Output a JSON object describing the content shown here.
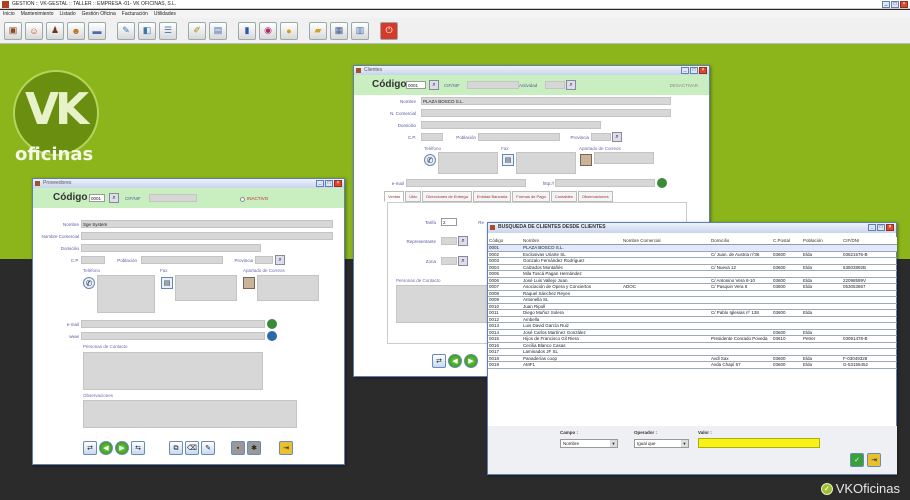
{
  "app": {
    "title": "GESTION :: VK-GESTAL :: TALLER :: EMPRESA -01- VK OFICINAS, S.L.",
    "menu": [
      "Inicio",
      "Mantenimiento",
      "Listado",
      "Gestión Oficina",
      "Facturación",
      "Utilidades"
    ],
    "toolbar_icons": [
      "briefcase-icon",
      "person-icon",
      "people-icon",
      "group-icon",
      "truck-icon",
      "document-icon",
      "edit-icon",
      "list-icon",
      "notebook-icon",
      "chart-icon",
      "globe-icon",
      "coin-icon",
      "folder-icon",
      "calculator-icon",
      "printer-icon",
      "exit-icon"
    ],
    "brand": "VKOficinas",
    "logo_text": "oficinas",
    "logo_mark": "VK"
  },
  "proveedores": {
    "title": "Proveedores",
    "codigo_label": "Código",
    "codigo_value": "0001",
    "cifnif_label": "CIF/NIF",
    "inactivo_label": "INACTIVO",
    "nombre_label": "Nombre",
    "nombre_value": "Sge System",
    "nombre_comercial_label": "Nombre Comercial",
    "domicilio_label": "Domicilio",
    "cp_label": "C.P.",
    "poblacion_label": "Población",
    "provincia_label": "Provincia",
    "telefono_label": "Teléfono",
    "fax_label": "Fax",
    "apartado_label": "Apartado de Correos",
    "email_label": "e-mail",
    "web_label": "www",
    "contacto_label": "Personas de Contacto",
    "observaciones_label": "Observaciones"
  },
  "clientes": {
    "title": "Clientes",
    "codigo_label": "Código",
    "codigo_value": "0001",
    "cifnif_label": "CIF/NIF",
    "actividad_label": "Actividad",
    "desactivar_label": "DESACTIVAR",
    "nombre_label": "Nombre",
    "nombre_value": "PLAZA BOSCO S.L.",
    "nombre_comercial_label": "N. Comercial",
    "domicilio_label": "Domicilio",
    "cp_label": "C.P.",
    "poblacion_label": "Población",
    "provincia_label": "Provincia",
    "telefono_label": "Teléfono",
    "fax_label": "Fax",
    "apartado_label": "Apartado de Correos",
    "email_label": "e-mail",
    "web_label": "http://",
    "tabs": [
      "Ventas",
      "Ubic",
      "Direcciones de Entrega",
      "Entidad Bancaria",
      "Formas de Pago",
      "Contables",
      "Observaciones"
    ],
    "tarifa_label": "Tarifa",
    "tarifa_value": "2",
    "representante_label": "Representante",
    "zona_label": "Zona",
    "recargo_label": "Re",
    "contacto_label": "Personas de Contacto"
  },
  "busqueda": {
    "title": "BUSQUEDA DE CLIENTES DESDE CLIENTES",
    "columns": [
      "Código",
      "Nombre",
      "Nombre Comercial",
      "Domicilio",
      "C.Postal",
      "Población",
      "CIF/DNI"
    ],
    "rows": [
      [
        "0001",
        "PLAZA BOSCO S.L.",
        "",
        "",
        "",
        "",
        ""
      ],
      [
        "0002",
        "Exclusivas Uriarte SL",
        "",
        "C/ Juan. de Austria nº36",
        "03600",
        "Elda",
        "03621576-B"
      ],
      [
        "0003",
        "Gonzalo Fernández Rodríguez",
        "",
        "",
        "",
        "",
        ""
      ],
      [
        "0004",
        "Calzados Montañés",
        "",
        "C/ Nueva 12",
        "03600",
        "Elda",
        "53503892B"
      ],
      [
        "0005",
        "Mila Toscá Pagan Hernández",
        "",
        "",
        "",
        "",
        ""
      ],
      [
        "0006",
        "José Luis Vallejo Juan",
        "",
        "C/ Antonino Vera 8-10",
        "03600",
        "Elda",
        "22098589V"
      ],
      [
        "0007",
        "Asociación de Opera y Conciertos",
        "ADOC",
        "C/ Pasquin Vera 6",
        "03600",
        "Elda",
        "053053867"
      ],
      [
        "0008",
        "Raquel Sánchez Reyes",
        "",
        "",
        "",
        "",
        ""
      ],
      [
        "0009",
        "Antonella SL",
        "",
        "",
        "",
        "",
        ""
      ],
      [
        "0010",
        "Juan Ripoll",
        "",
        "",
        "",
        "",
        ""
      ],
      [
        "0011",
        "Diego Muñoz Solera",
        "",
        "C/ Pablo Iglesias nº 138",
        "03600",
        "Elda",
        ""
      ],
      [
        "0012",
        "Ambella",
        "",
        "",
        "",
        "",
        ""
      ],
      [
        "0013",
        "Luis David García Ruiz",
        "",
        "",
        "",
        "",
        ""
      ],
      [
        "0014",
        "José Carlos Martínez González",
        "",
        "",
        "03600",
        "Elda",
        ""
      ],
      [
        "0015",
        "Hijos de Francisco Gil Riera",
        "",
        "Presidente Conrado Poveda",
        "03610",
        "Petrer",
        "03091478-B"
      ],
      [
        "0016",
        "Cecilia Blanco Casas",
        "",
        "",
        "",
        "",
        ""
      ],
      [
        "0017",
        "Laminados JF SL",
        "",
        "",
        "",
        "",
        ""
      ],
      [
        "0018",
        "Panaderías coop",
        "",
        "Avdl Sax",
        "03600",
        "Elda",
        "F-03049328"
      ],
      [
        "0019",
        "AMF1",
        "",
        "Avda Chapí 67",
        "03600",
        "Elda",
        "G-53156452"
      ]
    ],
    "campo_label": "Campo :",
    "campo_value": "Nombre",
    "operador_label": "Operador :",
    "operador_value": "Igual que",
    "valor_label": "Valor :",
    "valor_value": ""
  },
  "colors": {
    "desktop_green": "#8bb51a",
    "desktop_dark": "#2b2b2b",
    "code_bar": "#c9efc0",
    "valor_field": "#f7f21a"
  }
}
